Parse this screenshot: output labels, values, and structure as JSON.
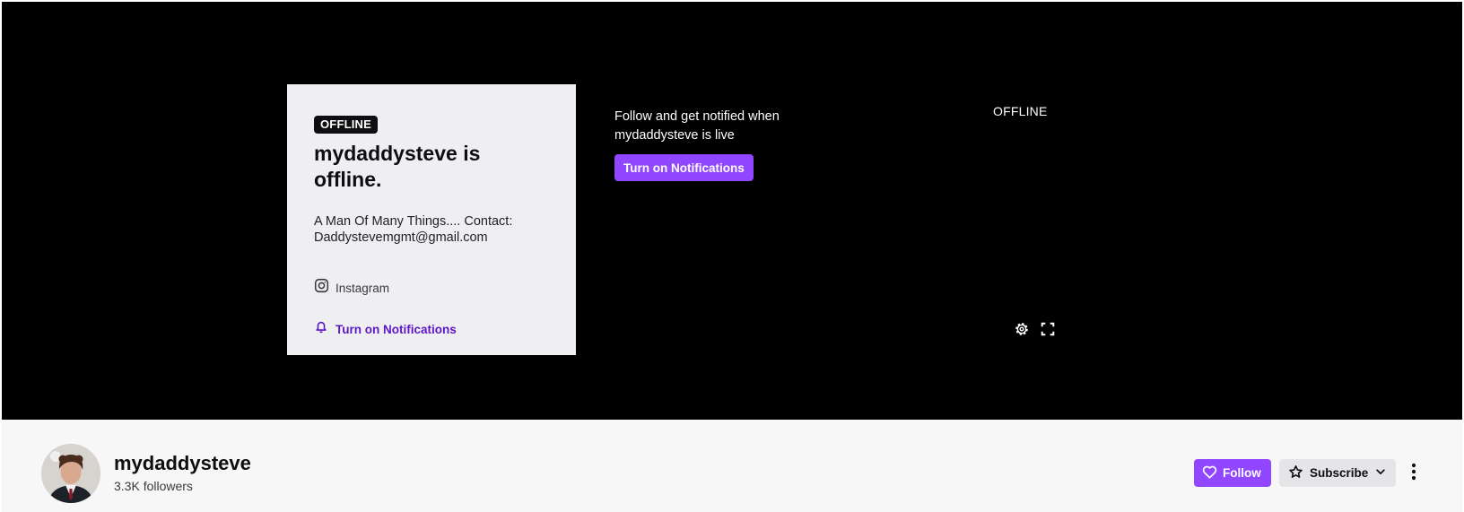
{
  "player": {
    "offline_badge": "OFFLINE",
    "card_title": "mydaddysteve is offline.",
    "card_description": "A Man Of Many Things.... Contact: Daddystevemgmt@gmail.com",
    "social_link_label": "Instagram",
    "card_notifications_label": "Turn on Notifications",
    "promo_text": "Follow and get notified when mydaddysteve is live",
    "promo_button_label": "Turn on Notifications",
    "offline_label": "OFFLINE",
    "controls": {
      "settings_icon": "gear-icon",
      "fullscreen_icon": "fullscreen-icon"
    }
  },
  "channel": {
    "name": "mydaddysteve",
    "followers": "3.3K followers",
    "follow_label": "Follow",
    "subscribe_label": "Subscribe"
  },
  "colors": {
    "accent": "#9147ff",
    "accent_text": "#5c16c5",
    "card_background": "#efeff1",
    "player_background": "#000000",
    "bar_background": "#f7f7f8"
  }
}
